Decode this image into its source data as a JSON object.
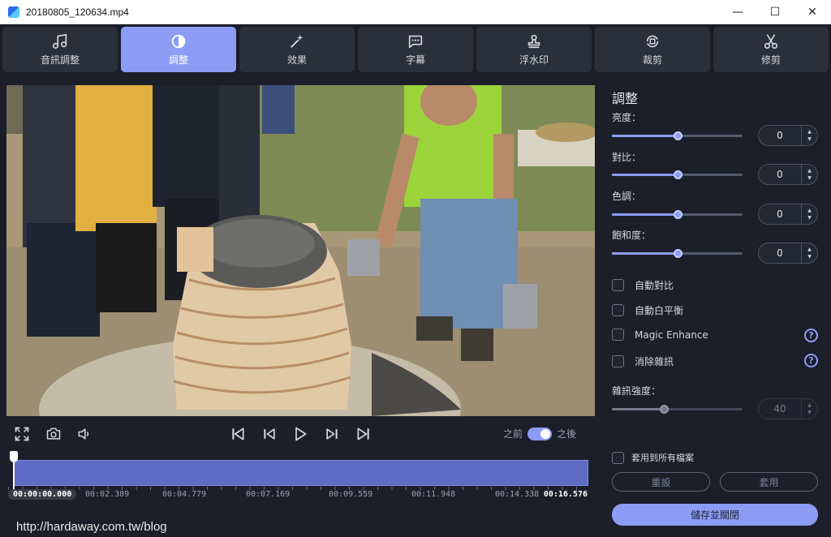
{
  "window": {
    "title": "20180805_120634.mp4",
    "minimize": "—",
    "maximize": "☐",
    "close": "✕"
  },
  "tabs": [
    {
      "label": "音訊調整",
      "icon": "music-note-icon"
    },
    {
      "label": "調整",
      "icon": "contrast-icon",
      "active": true
    },
    {
      "label": "效果",
      "icon": "magic-wand-icon"
    },
    {
      "label": "字幕",
      "icon": "speech-bubble-icon"
    },
    {
      "label": "浮水印",
      "icon": "stamp-icon"
    },
    {
      "label": "裁剪",
      "icon": "rotate-crop-icon"
    },
    {
      "label": "修剪",
      "icon": "scissors-icon"
    }
  ],
  "player": {
    "compare_before": "之前",
    "compare_after": "之後",
    "compare_on": true
  },
  "timeline": {
    "current": "00:00:00.000",
    "ticks": [
      "00:02.389",
      "00:04.779",
      "00:07.169",
      "00:09.559",
      "00:11.948",
      "00:14.338"
    ],
    "end": "00:16.576",
    "progress": 0.0
  },
  "adjust": {
    "title": "調整",
    "sliders": [
      {
        "label": "亮度：",
        "value": "0",
        "level": 0.5
      },
      {
        "label": "對比：",
        "value": "0",
        "level": 0.5
      },
      {
        "label": "色調：",
        "value": "0",
        "level": 0.5
      },
      {
        "label": "飽和度：",
        "value": "0",
        "level": 0.5
      }
    ],
    "checks": [
      {
        "label": "自動對比",
        "checked": false
      },
      {
        "label": "自動白平衡",
        "checked": false
      },
      {
        "label": "Magic Enhance",
        "checked": false,
        "help": true
      },
      {
        "label": "消除雜訊",
        "checked": false,
        "help": true
      }
    ],
    "noise": {
      "label": "雜訊強度：",
      "value": "40",
      "level": 0.4
    },
    "apply_all": "套用到所有檔案",
    "reset": "重設",
    "apply": "套用",
    "save_close": "儲存並關閉"
  },
  "watermark": "http://hardaway.com.tw/blog",
  "colors": {
    "accent": "#8c9cf5",
    "background": "#1c1f2a",
    "timeline": "#5d6bc4"
  }
}
